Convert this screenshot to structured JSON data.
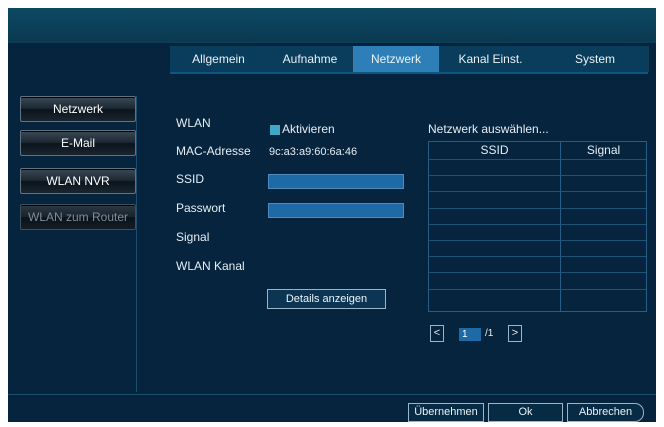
{
  "tabs": [
    {
      "label": "Allgemein"
    },
    {
      "label": "Aufnahme"
    },
    {
      "label": "Netzwerk"
    },
    {
      "label": "Kanal Einst."
    },
    {
      "label": "System"
    }
  ],
  "active_tab": "Netzwerk",
  "sidebar": {
    "items": [
      {
        "label": "Netzwerk"
      },
      {
        "label": "E-Mail"
      },
      {
        "label": "WLAN NVR"
      },
      {
        "label": "WLAN zum Router"
      }
    ]
  },
  "form": {
    "wlan_label": "WLAN",
    "activate_label": "Aktivieren",
    "mac_label": "MAC-Adresse",
    "mac_value": "9c:a3:a9:60:6a:46",
    "ssid_label": "SSID",
    "ssid_value": "",
    "password_label": "Passwort",
    "password_value": "",
    "signal_label": "Signal",
    "channel_label": "WLAN Kanal",
    "details_button": "Details anzeigen"
  },
  "network": {
    "title": "Netzwerk auswählen...",
    "columns": [
      "SSID",
      "Signal"
    ],
    "rows": []
  },
  "pager": {
    "prev": "<",
    "next": ">",
    "current": "1",
    "total": "/1"
  },
  "footer": {
    "apply": "Übernehmen",
    "ok": "Ok",
    "cancel": "Abbrechen"
  },
  "colors": {
    "background": "#06243d",
    "active_tab": "#2e7fb8",
    "input_fill": "#1d6aa7",
    "checkbox": "#3fa8c8"
  }
}
